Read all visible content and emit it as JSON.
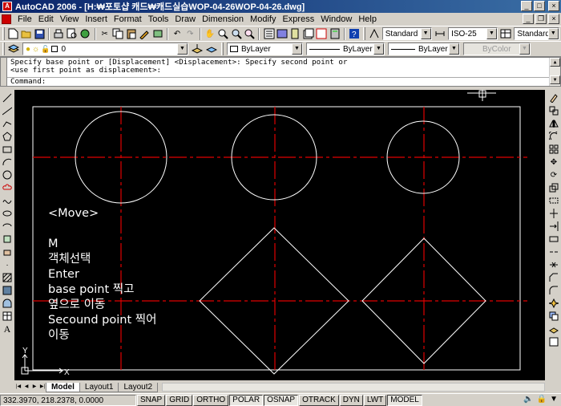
{
  "window": {
    "title": "AutoCAD 2006 - [H:₩포토샵 캐드₩캐드실습WOP-04-26WOP-04-26.dwg]",
    "minimize": "_",
    "maximize": "□",
    "close": "×",
    "mdi_restore": "❐",
    "mdi_close": "×"
  },
  "menu": [
    "File",
    "Edit",
    "View",
    "Insert",
    "Format",
    "Tools",
    "Draw",
    "Dimension",
    "Modify",
    "Express",
    "Window",
    "Help"
  ],
  "styles_toolbar": {
    "text_style": "Standard",
    "dim_style": "ISO-25",
    "table_style": "Standard"
  },
  "layers_toolbar": {
    "layer": "0",
    "color": "ByLayer",
    "linetype": "ByLayer",
    "lineweight": "ByLayer",
    "plot_style": "ByColor"
  },
  "command": {
    "line1": "Specify base point or [Displacement] <Displacement>: Specify second point or",
    "line2": "<use first point as displacement>:",
    "prompt": "Command:"
  },
  "annotation": {
    "line1": "<Move>",
    "line2": "",
    "line3": "M",
    "line4": "객체선택",
    "line5": "Enter",
    "line6": "base point 찍고",
    "line7": "옆으로 이동",
    "line8": "Secound point 찍어",
    "line9": "이동"
  },
  "ucs": {
    "y": "Y",
    "x": "X"
  },
  "tabs": [
    "Model",
    "Layout1",
    "Layout2"
  ],
  "status": {
    "coords": "332.3970, 218.2378, 0.0000",
    "buttons": [
      {
        "label": "SNAP",
        "on": false
      },
      {
        "label": "GRID",
        "on": false
      },
      {
        "label": "ORTHO",
        "on": false
      },
      {
        "label": "POLAR",
        "on": true
      },
      {
        "label": "OSNAP",
        "on": true
      },
      {
        "label": "OTRACK",
        "on": false
      },
      {
        "label": "DYN",
        "on": false
      },
      {
        "label": "LWT",
        "on": false
      },
      {
        "label": "MODEL",
        "on": true
      }
    ]
  },
  "colors": {
    "canvas": "#000000",
    "geometry": "#ffffff",
    "centerline": "#e00000",
    "titlebar": "#0a246a"
  }
}
